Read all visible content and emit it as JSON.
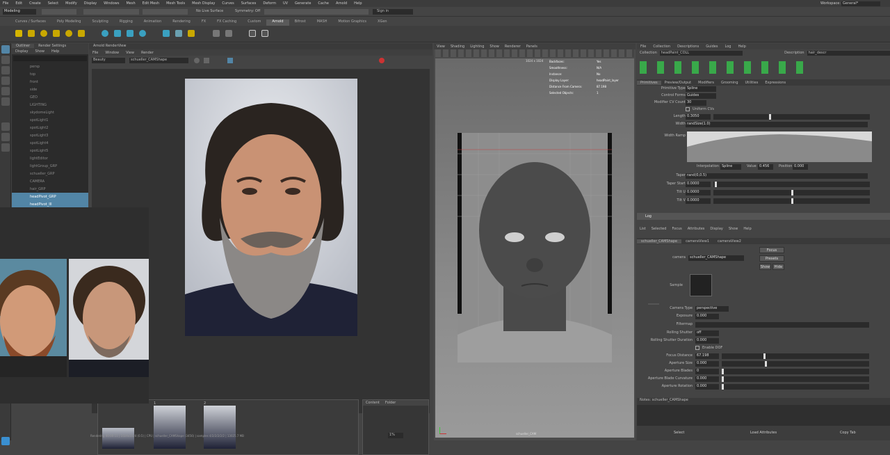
{
  "menubar": {
    "items": [
      "File",
      "Edit",
      "Create",
      "Select",
      "Modify",
      "Display",
      "Windows",
      "Mesh",
      "Edit Mesh",
      "Mesh Tools",
      "Mesh Display",
      "Curves",
      "Surfaces",
      "Deform",
      "UV",
      "Generate",
      "Cache",
      "Arnold",
      "Help"
    ],
    "workspace_label": "Workspace:",
    "workspace_value": "General*"
  },
  "statusline": {
    "mode": "Modeling",
    "live_surface": "No Live Surface",
    "symmetry": "Symmetry: Off",
    "login": "Sign in"
  },
  "shelf": {
    "tabs": [
      "Curves / Surfaces",
      "Poly Modeling",
      "Sculpting",
      "Rigging",
      "Animation",
      "Rendering",
      "FX",
      "FX Caching",
      "Custom",
      "Arnold",
      "Bifrost",
      "MASH",
      "Motion Graphics",
      "XGen"
    ],
    "active_tab": "Arnold"
  },
  "outliner": {
    "tabs": [
      "Outliner",
      "Render Settings"
    ],
    "menu": [
      "Display",
      "Show",
      "Help"
    ],
    "items": [
      {
        "label": "persp",
        "selected": false
      },
      {
        "label": "top",
        "selected": false
      },
      {
        "label": "front",
        "selected": false
      },
      {
        "label": "side",
        "selected": false
      },
      {
        "label": "GEO",
        "selected": false
      },
      {
        "label": "LIGHTING",
        "selected": false
      },
      {
        "label": "skydomeLight",
        "selected": false
      },
      {
        "label": "spotLight1",
        "selected": false
      },
      {
        "label": "spotLight2",
        "selected": false
      },
      {
        "label": "spotLight3",
        "selected": false
      },
      {
        "label": "spotLight4",
        "selected": false
      },
      {
        "label": "spotLight5",
        "selected": false
      },
      {
        "label": "lightEditor",
        "selected": false
      },
      {
        "label": "lightGroup_GRP",
        "selected": false
      },
      {
        "label": "schueller_GRP",
        "selected": false
      },
      {
        "label": "CAMERA",
        "selected": false
      },
      {
        "label": "hair_GRP",
        "selected": false
      },
      {
        "label": "headPivot_GRP",
        "selected": true
      },
      {
        "label": "headPivot_Ill",
        "selected": true
      }
    ]
  },
  "renderview": {
    "title": "Arnold RenderView",
    "menu": [
      "File",
      "Window",
      "View",
      "Render"
    ],
    "aov": "Beauty",
    "camera": "schueller_CAMShape",
    "snapshots": [
      "1",
      "2"
    ],
    "content_tabs": [
      "Content",
      "Folder"
    ],
    "status": "Rendering 00:00:11 | 1024x1024 (0.5) | CPU | schueller_CAMShape (3456) | samples 4/2/2/2/2/2 | 13025.7 MB",
    "zoom": "1%"
  },
  "viewport": {
    "menu": [
      "View",
      "Shading",
      "Lighting",
      "Show",
      "Renderer",
      "Panels"
    ],
    "resolution": "1024 x 1024",
    "hud": [
      {
        "label": "Backfaces:",
        "value": "Yes"
      },
      {
        "label": "Smoothness:",
        "value": "N/A"
      },
      {
        "label": "Instance:",
        "value": "No"
      },
      {
        "label": "Display Layer:",
        "value": "headPaint_layer"
      },
      {
        "label": "Distance From Camera:",
        "value": "87.198"
      },
      {
        "label": "Selected Objects:",
        "value": "1"
      }
    ],
    "camera_label": "schueller_CAM"
  },
  "attribute_editor": {
    "menu": [
      "File",
      "Collection",
      "Descriptions",
      "Guides",
      "Log",
      "Help"
    ],
    "collection_label": "Collection",
    "collection_value": "headPaint_COLL",
    "description_label": "Description",
    "description_value": "hair_descr",
    "tabs": [
      "Primitives",
      "Preview/Output",
      "Modifiers",
      "Grooming",
      "Utilities",
      "Expressions"
    ],
    "primitive_type_label": "Primitive Type",
    "primitive_type": "Spline",
    "control_for_label": "Control Forms",
    "control_for": "Guides",
    "modifier_cv_label": "Modifier CV Count",
    "modifier_cv": "30",
    "uniform_cv": "Uniform CVs",
    "length_label": "Length",
    "length": "0.3050",
    "width_label": "Width",
    "width": "randSize(1.0)",
    "width_ramp_label": "Width Ramp",
    "interp_label": "Interpolation",
    "interp": "Spline",
    "value_label": "Value",
    "value": "0.456",
    "position_label": "Position",
    "position": "0.000",
    "taper_label": "Taper",
    "taper": "rand(0,0.5)",
    "taper_start_label": "Taper Start",
    "taper_start": "0.0000",
    "tilt_u_label": "Tilt U",
    "tilt_u": "0.0000",
    "tilt_v_label": "Tilt V",
    "tilt_v": "0.0000",
    "section_log": "Log",
    "lower_menu": [
      "List",
      "Selected",
      "Focus",
      "Attributes",
      "Display",
      "Show",
      "Help"
    ],
    "lower_tabs": [
      "schueller_CAMShape",
      "cameraView1",
      "cameraView2"
    ],
    "camera_label": "camera",
    "camera_value": "schueller_CAMShape",
    "focus_btn": "Focus",
    "presets_btn": "Presets",
    "show_btn": "Show",
    "hide_btn": "Hide",
    "sample_label": "Sample",
    "camera_type_label": "Camera Type",
    "camera_type": "perspective",
    "exposure_label": "Exposure",
    "exposure": "0.000",
    "filtermap_label": "Filtermap",
    "rolling_shutter_label": "Rolling Shutter",
    "rolling_shutter": "off",
    "rolling_duration_label": "Rolling Shutter Duration",
    "rolling_duration": "0.000",
    "enable_dof": "Enable DOF",
    "focus_distance_label": "Focus Distance",
    "focus_distance": "67.198",
    "aperture_size_label": "Aperture Size",
    "aperture_size": "0.000",
    "aperture_blades_label": "Aperture Blades",
    "aperture_blades": "0",
    "blade_curvature_label": "Aperture Blade Curvature",
    "blade_curvature": "0.000",
    "aperture_rotation_label": "Aperture Rotation",
    "aperture_rotation": "0.000",
    "notes_label": "Notes: schueller_CAMShape",
    "bottom_buttons": [
      "Select",
      "Load Attributes",
      "Copy Tab"
    ]
  },
  "colors": {
    "selection": "#5285a6",
    "panel": "#444444",
    "dark_field": "#2b2b2b"
  }
}
